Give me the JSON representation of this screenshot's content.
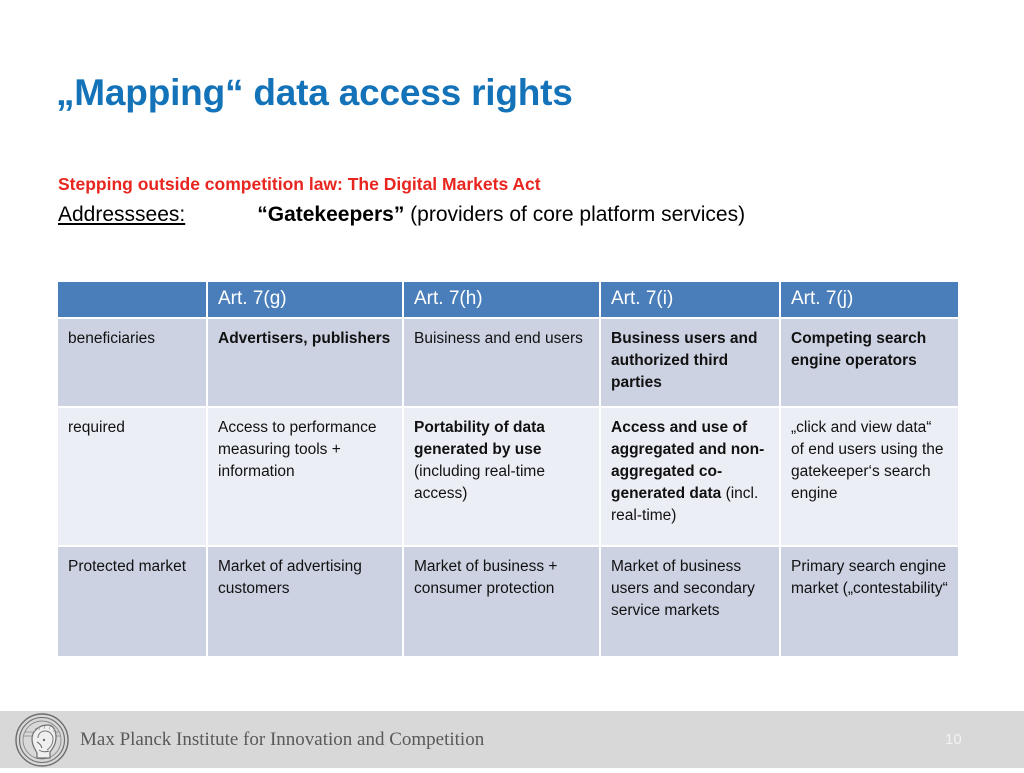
{
  "slide": {
    "title": "„Mapping“ data access rights",
    "subtitle_red": "Stepping outside competition law: The Digital Markets Act",
    "addressees": {
      "label": "Addresssees:",
      "bold": "“Gatekeepers”",
      "rest": " (providers of core platform services)"
    },
    "accent_blue": "#1473b8",
    "accent_red": "#e8251f",
    "table_header_blue": "#4a7ebb",
    "row_shade": "#ccd2e2",
    "row_light": "#eceef5"
  },
  "table": {
    "headers": [
      "",
      "Art. 7(g)",
      "Art. 7(h)",
      "Art. 7(i)",
      "Art. 7(j)"
    ],
    "rows": [
      {
        "label": "beneficiaries",
        "cells": [
          {
            "strong": "Advertisers, publishers",
            "sub": ""
          },
          {
            "strong": "",
            "sub": "Buisiness and end users"
          },
          {
            "strong": "Business users and authorized third parties",
            "sub": ""
          },
          {
            "strong": "Competing search engine operators",
            "sub": ""
          }
        ]
      },
      {
        "label": "required",
        "cells": [
          {
            "strong": "",
            "sub": "Access to performance measuring tools + information"
          },
          {
            "strong": "Portability of data generated by use ",
            "sub": "(including real-time access)"
          },
          {
            "strong": "Access and use of aggregated and non-aggregated co-generated data ",
            "sub": "(incl. real-time)"
          },
          {
            "strong": "",
            "sub": "„click and view data“ of end users using the gatekeeper‘s search engine"
          }
        ]
      },
      {
        "label": "Protected market",
        "cells": [
          {
            "strong": "",
            "sub": "Market of advertising customers"
          },
          {
            "strong": "",
            "sub": "Market of business + consumer protection"
          },
          {
            "strong": "",
            "sub": "Market of business users and secondary service markets"
          },
          {
            "strong": "",
            "sub": "Primary search engine market („contestability“"
          }
        ]
      }
    ]
  },
  "footer": {
    "institute": "Max Planck Institute for Innovation and Competition",
    "page_number": "10",
    "logo_icon": "minerva-head-logo-icon"
  }
}
